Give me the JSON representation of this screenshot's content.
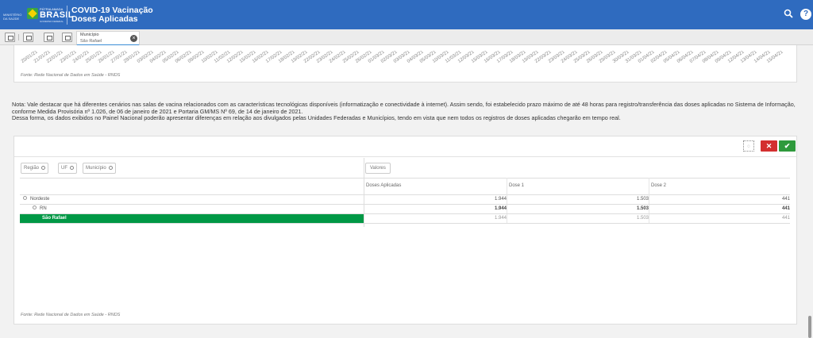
{
  "header": {
    "ministry": "MINISTÉRIO DA SAÚDE",
    "patria": "PÁTRIA AMADA",
    "brasil": "BRASIL",
    "gov": "GOVERNO FEDERAL",
    "title_line1": "COVID-19 Vacinação",
    "title_line2": "Doses Aplicadas"
  },
  "selection": {
    "field_label": "Município",
    "field_value": "São Rafael"
  },
  "chart_top": {
    "dates": [
      "20/01/21",
      "21/01/21",
      "22/01/21",
      "23/01/21",
      "24/01/21",
      "25/01/21",
      "26/01/21",
      "27/01/21",
      "28/01/21",
      "03/02/21",
      "04/02/21",
      "05/02/21",
      "06/02/21",
      "09/02/21",
      "10/02/21",
      "11/02/21",
      "12/02/21",
      "15/02/21",
      "16/02/21",
      "17/02/21",
      "18/02/21",
      "19/02/21",
      "22/02/21",
      "23/02/21",
      "24/02/21",
      "25/02/21",
      "26/02/21",
      "01/03/21",
      "02/03/21",
      "03/03/21",
      "04/03/21",
      "05/03/21",
      "10/03/21",
      "11/03/21",
      "12/03/21",
      "15/03/21",
      "16/03/21",
      "17/03/21",
      "18/03/21",
      "19/03/21",
      "22/03/21",
      "23/03/21",
      "24/03/21",
      "25/03/21",
      "26/03/21",
      "29/03/21",
      "30/03/21",
      "31/03/21",
      "01/04/21",
      "02/04/21",
      "05/04/21",
      "06/04/21",
      "07/04/21",
      "08/04/21",
      "09/04/21",
      "12/04/21",
      "13/04/21",
      "14/04/21",
      "15/04/21"
    ],
    "source": "Fonte: Rede Nacional de Dados em Saúde - RNDS"
  },
  "note": {
    "line1": "Nota: Vale destacar que há diferentes cenários nas salas de vacina relacionados com as características tecnológicas disponíveis (informatização e conectividade à internet). Assim sendo, foi estabelecido prazo máximo de até 48 horas para registro/transferência das doses aplicadas no Sistema de Informação, conforme Medida Provisória nº 1.026, de 06 de janeiro de 2021 e Portaria GM/MS Nº 69, de 14 de janeiro de 2021.",
    "line2": "Dessa forma, os dados exibidos no Painel Nacional poderão apresentar diferenças em relação aos divulgados pelas Unidades Federadas e Municípios, tendo em vista que nem todos os registros de doses aplicadas chegarão em tempo real."
  },
  "table": {
    "dimensions": [
      "Região",
      "UF",
      "Município"
    ],
    "values_label": "Valores",
    "columns": [
      "Doses Aplicadas",
      "Dose 1",
      "Dose 2"
    ],
    "rows": [
      {
        "label": "Nordeste",
        "doses": "1.944",
        "dose1": "1.503",
        "dose2": "441"
      },
      {
        "label": "RN",
        "doses": "1.944",
        "dose1": "1.503",
        "dose2": "441"
      },
      {
        "label": "São Rafael",
        "doses": "1.944",
        "dose1": "1.503",
        "dose2": "441"
      }
    ],
    "source": "Fonte: Rede Nacional de Dados em Saúde - RNDS"
  },
  "colors": {
    "header_blue": "#2f6bbf",
    "selected_green": "#009845",
    "cancel_red": "#d32f2f",
    "confirm_green": "#2e9a3c"
  },
  "icons": [
    "search-icon",
    "help-icon",
    "clear-selection-icon",
    "close-icon",
    "check-icon",
    "lasso-select-icon",
    "collapse-minus-icon"
  ]
}
